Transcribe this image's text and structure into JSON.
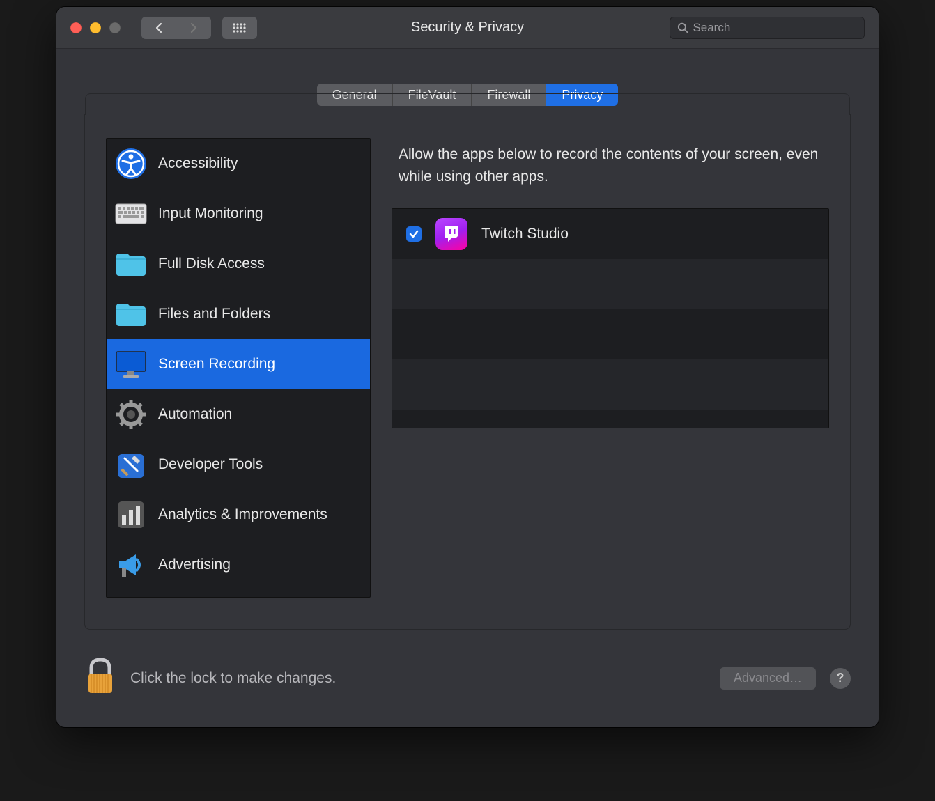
{
  "window": {
    "title": "Security & Privacy"
  },
  "search": {
    "placeholder": "Search",
    "value": ""
  },
  "tabs": {
    "items": [
      "General",
      "FileVault",
      "Firewall",
      "Privacy"
    ],
    "active_index": 3
  },
  "sidebar": {
    "items": [
      {
        "label": "Accessibility",
        "icon": "accessibility-icon"
      },
      {
        "label": "Input Monitoring",
        "icon": "keyboard-icon"
      },
      {
        "label": "Full Disk Access",
        "icon": "folder-icon"
      },
      {
        "label": "Files and Folders",
        "icon": "folder-icon"
      },
      {
        "label": "Screen Recording",
        "icon": "display-icon"
      },
      {
        "label": "Automation",
        "icon": "gear-icon"
      },
      {
        "label": "Developer Tools",
        "icon": "hammer-icon"
      },
      {
        "label": "Analytics & Improvements",
        "icon": "chart-icon"
      },
      {
        "label": "Advertising",
        "icon": "megaphone-icon"
      }
    ],
    "selected_index": 4
  },
  "detail": {
    "description": "Allow the apps below to record the contents of your screen, even while using other apps.",
    "apps": [
      {
        "name": "Twitch Studio",
        "checked": true,
        "icon": "twitch-icon"
      }
    ]
  },
  "footer": {
    "lock_text": "Click the lock to make changes.",
    "advanced_label": "Advanced…",
    "help_label": "?"
  }
}
